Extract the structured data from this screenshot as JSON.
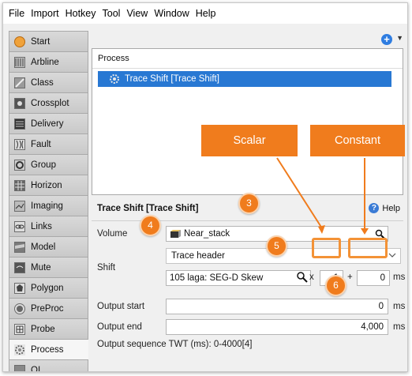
{
  "menu": [
    "File",
    "Import",
    "Hotkey",
    "Tool",
    "View",
    "Window",
    "Help"
  ],
  "sidebar": {
    "items": [
      {
        "label": "Start",
        "icon": "start-icon"
      },
      {
        "label": "Arbline",
        "icon": "arbline-icon"
      },
      {
        "label": "Class",
        "icon": "class-icon"
      },
      {
        "label": "Crossplot",
        "icon": "crossplot-icon"
      },
      {
        "label": "Delivery",
        "icon": "delivery-icon"
      },
      {
        "label": "Fault",
        "icon": "fault-icon"
      },
      {
        "label": "Group",
        "icon": "group-icon"
      },
      {
        "label": "Horizon",
        "icon": "horizon-icon"
      },
      {
        "label": "Imaging",
        "icon": "imaging-icon"
      },
      {
        "label": "Links",
        "icon": "links-icon"
      },
      {
        "label": "Model",
        "icon": "model-icon"
      },
      {
        "label": "Mute",
        "icon": "mute-icon"
      },
      {
        "label": "Polygon",
        "icon": "polygon-icon"
      },
      {
        "label": "PreProc",
        "icon": "preproc-icon"
      },
      {
        "label": "Probe",
        "icon": "probe-icon"
      },
      {
        "label": "Process",
        "icon": "process-icon",
        "active": true
      },
      {
        "label": "QI",
        "icon": "qi-icon"
      }
    ]
  },
  "process_panel": {
    "header": "Process",
    "items": [
      "Trace Shift [Trace Shift]"
    ]
  },
  "detail": {
    "title": "Trace Shift [Trace Shift]",
    "help": "Help",
    "volume_label": "Volume",
    "volume_value": "Near_stack",
    "shift_label": "Shift",
    "shift_mode": "Trace header",
    "header_value": "105 laga: SEG-D Skew",
    "multiply": "x",
    "scalar_value": "1",
    "plus": "+",
    "constant_value": "0",
    "unit": "ms",
    "output_start_label": "Output start",
    "output_start_value": "0",
    "output_end_label": "Output end",
    "output_end_value": "4,000",
    "output_sequence": "Output sequence TWT (ms): 0-4000[4]"
  },
  "annotations": {
    "callouts": [
      "Scalar",
      "Constant"
    ],
    "badges": [
      "3",
      "4",
      "5",
      "6"
    ],
    "color": "#f07c1d"
  }
}
